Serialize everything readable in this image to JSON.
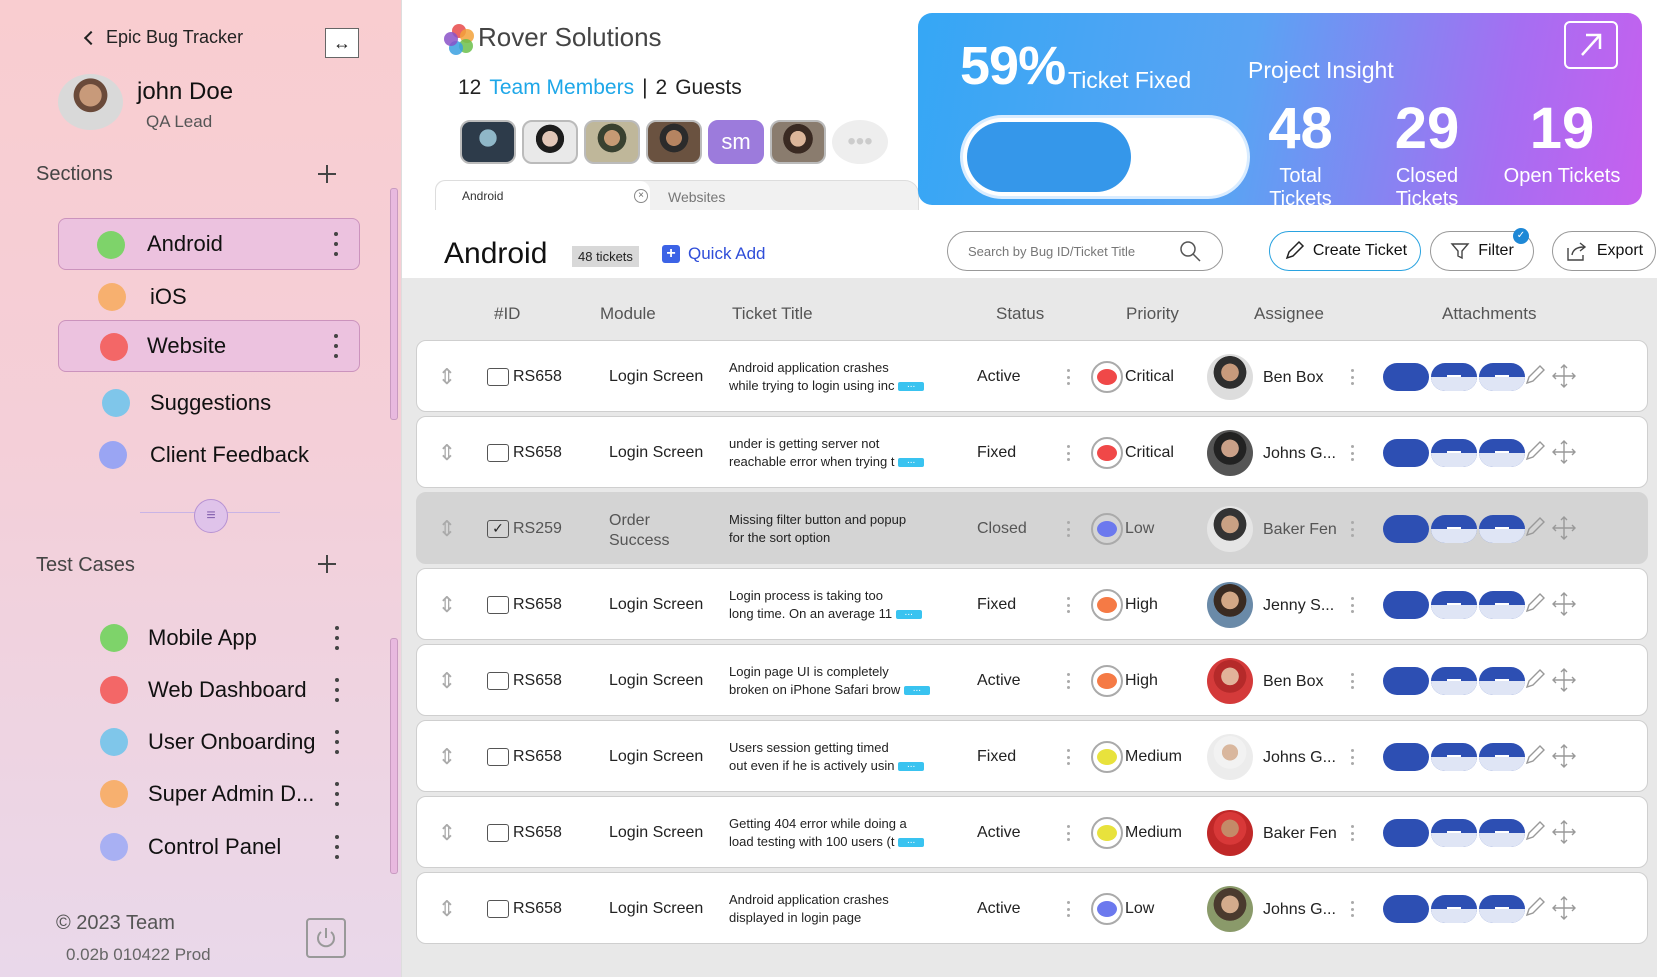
{
  "sidebar": {
    "back_label": "Epic Bug Tracker",
    "user_name": "john Doe",
    "user_role": "QA Lead",
    "sections_title": "Sections",
    "sections": [
      {
        "label": "Android",
        "color": "#7ed36a",
        "selected": true
      },
      {
        "label": "iOS",
        "color": "#f7b06f",
        "selected": false
      },
      {
        "label": "Website",
        "color": "#f36767",
        "selected": true
      },
      {
        "label": "Suggestions",
        "color": "#7fc6ea",
        "selected": false
      },
      {
        "label": "Client Feedback",
        "color": "#9aa5f3",
        "selected": false
      }
    ],
    "test_cases_title": "Test Cases",
    "test_cases": [
      {
        "label": "Mobile App",
        "color": "#7ed36a"
      },
      {
        "label": "Web Dashboard",
        "color": "#f36767"
      },
      {
        "label": "User Onboarding",
        "color": "#7fc6ea"
      },
      {
        "label": "Super Admin D...",
        "color": "#f7b06f"
      },
      {
        "label": "Control Panel",
        "color": "#a8b0f3"
      }
    ],
    "copyright": "© 2023 Team",
    "version": "0.02b 010422 Prod"
  },
  "header": {
    "company": "Rover Solutions",
    "team_count": "12",
    "team_label": "Team Members",
    "guest_count": "2",
    "guest_label": "Guests",
    "avatar_initials": "sm",
    "tabs": [
      {
        "label": "Android",
        "active": true
      },
      {
        "label": "Websites",
        "active": false
      }
    ]
  },
  "insight": {
    "percent": "59%",
    "percent_label": "Ticket Fixed",
    "percent_value": 0.59,
    "title": "Project Insight",
    "total": "48",
    "total_label": "Total Tickets",
    "closed": "29",
    "closed_label": "Closed Tickets",
    "open": "19",
    "open_label": "Open Tickets"
  },
  "toolbar": {
    "title": "Android",
    "count": "48 tickets",
    "quick_add": "Quick Add",
    "search_placeholder": "Search by Bug ID/Ticket Title",
    "create": "Create Ticket",
    "filter": "Filter",
    "export": "Export"
  },
  "table": {
    "columns": [
      "#ID",
      "Module",
      "Ticket Title",
      "Status",
      "Priority",
      "Assignee",
      "Attachments"
    ],
    "priority_colors": {
      "Critical": "#f04848",
      "High": "#f57a45",
      "Medium": "#e8e23c",
      "Low": "#6c79ee"
    },
    "rows": [
      {
        "id": "RS658",
        "module": "Login Screen",
        "title1": "Android application crashes",
        "title2": "while trying to login using inc",
        "more": true,
        "status": "Active",
        "priority": "Critical",
        "assignee": "Ben Box",
        "checked": false,
        "dim": false
      },
      {
        "id": "RS658",
        "module": "Login Screen",
        "title1": "under is getting server not",
        "title2": "reachable error when trying t",
        "more": true,
        "status": "Fixed",
        "priority": "Critical",
        "assignee": "Johns G...",
        "checked": false,
        "dim": false
      },
      {
        "id": "RS259",
        "module": "Order Success",
        "title1": "Missing filter button and popup",
        "title2": "for the sort option",
        "more": false,
        "status": "Closed",
        "priority": "Low",
        "assignee": "Baker Fen",
        "checked": true,
        "dim": true
      },
      {
        "id": "RS658",
        "module": "Login Screen",
        "title1": "Login process is taking too",
        "title2": "long time. On an average 11",
        "more": true,
        "status": "Fixed",
        "priority": "High",
        "assignee": "Jenny S...",
        "checked": false,
        "dim": false
      },
      {
        "id": "RS658",
        "module": "Login Screen",
        "title1": "Login page UI is completely",
        "title2": "broken on iPhone Safari brow",
        "more": true,
        "status": "Active",
        "priority": "High",
        "assignee": "Ben Box",
        "checked": false,
        "dim": false
      },
      {
        "id": "RS658",
        "module": "Login Screen",
        "title1": "Users session getting timed",
        "title2": "out even if he is actively usin",
        "more": true,
        "status": "Fixed",
        "priority": "Medium",
        "assignee": "Johns G...",
        "checked": false,
        "dim": false
      },
      {
        "id": "RS658",
        "module": "Login Screen",
        "title1": "Getting 404 error while doing a",
        "title2": "load testing with 100 users (t",
        "more": true,
        "status": "Active",
        "priority": "Medium",
        "assignee": "Baker Fen",
        "checked": false,
        "dim": false
      },
      {
        "id": "RS658",
        "module": "Login Screen",
        "title1": "Android application crashes",
        "title2": "displayed in login page",
        "more": false,
        "status": "Active",
        "priority": "Low",
        "assignee": "Johns G...",
        "checked": false,
        "dim": false
      }
    ]
  }
}
